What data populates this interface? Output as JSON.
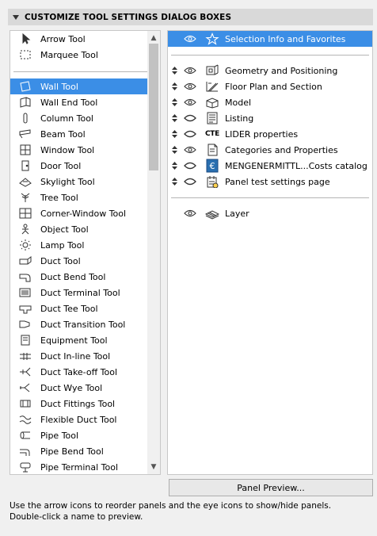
{
  "header": {
    "title": "CUSTOMIZE TOOL SETTINGS DIALOG BOXES"
  },
  "tools_top": [
    {
      "label": "Arrow Tool",
      "icon": "arrow-icon"
    },
    {
      "label": "Marquee Tool",
      "icon": "marquee-icon"
    }
  ],
  "tools": [
    {
      "label": "Wall Tool",
      "icon": "wall-icon",
      "selected": true
    },
    {
      "label": "Wall End Tool",
      "icon": "wall-end-icon"
    },
    {
      "label": "Column Tool",
      "icon": "column-icon"
    },
    {
      "label": "Beam Tool",
      "icon": "beam-icon"
    },
    {
      "label": "Window Tool",
      "icon": "window-icon"
    },
    {
      "label": "Door Tool",
      "icon": "door-icon"
    },
    {
      "label": "Skylight Tool",
      "icon": "skylight-icon"
    },
    {
      "label": "Tree Tool",
      "icon": "tree-icon"
    },
    {
      "label": "Corner-Window Tool",
      "icon": "corner-window-icon"
    },
    {
      "label": "Object Tool",
      "icon": "object-icon"
    },
    {
      "label": "Lamp Tool",
      "icon": "lamp-icon"
    },
    {
      "label": "Duct Tool",
      "icon": "duct-icon"
    },
    {
      "label": "Duct Bend Tool",
      "icon": "duct-bend-icon"
    },
    {
      "label": "Duct Terminal Tool",
      "icon": "duct-terminal-icon"
    },
    {
      "label": "Duct Tee Tool",
      "icon": "duct-tee-icon"
    },
    {
      "label": "Duct Transition Tool",
      "icon": "duct-transition-icon"
    },
    {
      "label": "Equipment Tool",
      "icon": "equipment-icon"
    },
    {
      "label": "Duct In-line Tool",
      "icon": "duct-inline-icon"
    },
    {
      "label": "Duct Take-off Tool",
      "icon": "duct-takeoff-icon"
    },
    {
      "label": "Duct Wye Tool",
      "icon": "duct-wye-icon"
    },
    {
      "label": "Duct Fittings Tool",
      "icon": "duct-fittings-icon"
    },
    {
      "label": "Flexible Duct Tool",
      "icon": "flexible-duct-icon"
    },
    {
      "label": "Pipe Tool",
      "icon": "pipe-icon"
    },
    {
      "label": "Pipe Bend Tool",
      "icon": "pipe-bend-icon"
    },
    {
      "label": "Pipe Terminal Tool",
      "icon": "pipe-terminal-icon"
    }
  ],
  "panels_top": [
    {
      "label": "Selection Info and Favorites",
      "icon": "star-icon",
      "eye": "open",
      "selected": true
    }
  ],
  "panels": [
    {
      "label": "Geometry and Positioning",
      "icon": "geometry-icon",
      "eye": "open"
    },
    {
      "label": "Floor Plan and Section",
      "icon": "floor-plan-icon",
      "eye": "open"
    },
    {
      "label": "Model",
      "icon": "model-icon",
      "eye": "open"
    },
    {
      "label": "Listing",
      "icon": "listing-icon",
      "eye": "closed"
    },
    {
      "label": "LIDER properties",
      "icon": "cte-icon",
      "icon_text": "CTE",
      "eye": "closed"
    },
    {
      "label": "Categories and Properties",
      "icon": "categories-icon",
      "eye": "open"
    },
    {
      "label": "MENGENERMITTL...Costs catalog",
      "icon": "costs-catalog-icon",
      "eye": "closed"
    },
    {
      "label": "Panel test settings page",
      "icon": "panel-test-icon",
      "eye": "closed"
    }
  ],
  "panels_bottom": [
    {
      "label": "Layer",
      "icon": "layer-icon",
      "eye": "open"
    }
  ],
  "preview_button": "Panel Preview...",
  "help": [
    "Use the arrow icons to reorder panels and the eye icons to show/hide panels.",
    "Double-click a name to preview."
  ]
}
